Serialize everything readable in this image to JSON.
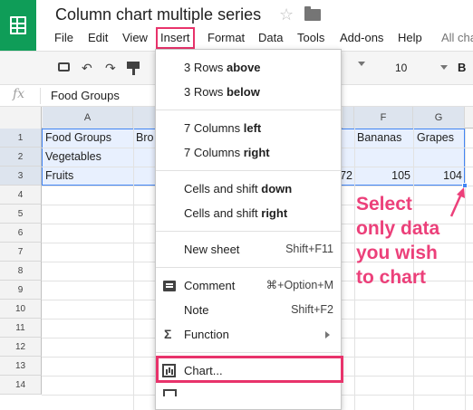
{
  "app": {
    "title": "Column chart multiple series",
    "icon": "sheets-icon",
    "accent": "#0f9d58"
  },
  "menubar": {
    "items": [
      "File",
      "Edit",
      "View",
      "Insert",
      "Format",
      "Data",
      "Tools",
      "Add-ons",
      "Help",
      "All cha"
    ],
    "active": "Insert",
    "highlight_color": "#e8336b"
  },
  "toolbar": {
    "font_size": "10",
    "bold_label": "B"
  },
  "formula_bar": {
    "fx_label": "fx",
    "value": "Food Groups"
  },
  "grid": {
    "columns": [
      "A",
      "",
      "",
      "",
      "",
      "F",
      "G"
    ],
    "rows": [
      "1",
      "2",
      "3",
      "4",
      "5",
      "6",
      "7",
      "8",
      "9",
      "10",
      "11",
      "12",
      "13",
      "14"
    ],
    "cells": {
      "a1": "Food Groups",
      "b1": "Bro",
      "f1": "Bananas",
      "g1": "Grapes",
      "a2": "Vegetables",
      "a3": "Fruits",
      "e3_partial": "72",
      "f3": "105",
      "g3": "104"
    },
    "selection_color": "#4285f4"
  },
  "insert_menu": {
    "items": [
      {
        "prefix": "3 Rows ",
        "bold": "above",
        "shortcut": "",
        "icon": ""
      },
      {
        "prefix": "3 Rows ",
        "bold": "below",
        "shortcut": "",
        "icon": ""
      },
      {
        "prefix": "7 Columns ",
        "bold": "left",
        "shortcut": "",
        "icon": ""
      },
      {
        "prefix": "7 Columns ",
        "bold": "right",
        "shortcut": "",
        "icon": ""
      },
      {
        "prefix": "Cells and shift ",
        "bold": "down",
        "shortcut": "",
        "icon": ""
      },
      {
        "prefix": "Cells and shift ",
        "bold": "right",
        "shortcut": "",
        "icon": ""
      },
      {
        "prefix": "New sheet",
        "bold": "",
        "shortcut": "Shift+F11",
        "icon": ""
      },
      {
        "prefix": "Comment",
        "bold": "",
        "shortcut": "⌘+Option+M",
        "icon": "comment-icon"
      },
      {
        "prefix": "Note",
        "bold": "",
        "shortcut": "Shift+F2",
        "icon": ""
      },
      {
        "prefix": "Function",
        "bold": "",
        "shortcut": "",
        "icon": "sigma-icon"
      },
      {
        "prefix": "Chart...",
        "bold": "",
        "shortcut": "",
        "icon": "chart-icon"
      }
    ],
    "function_icon_glyph": "Σ",
    "highlighted_item": "Chart..."
  },
  "annotation": {
    "lines": [
      "Select",
      "only data",
      "you wish",
      "to chart"
    ],
    "color": "#ec407a"
  }
}
